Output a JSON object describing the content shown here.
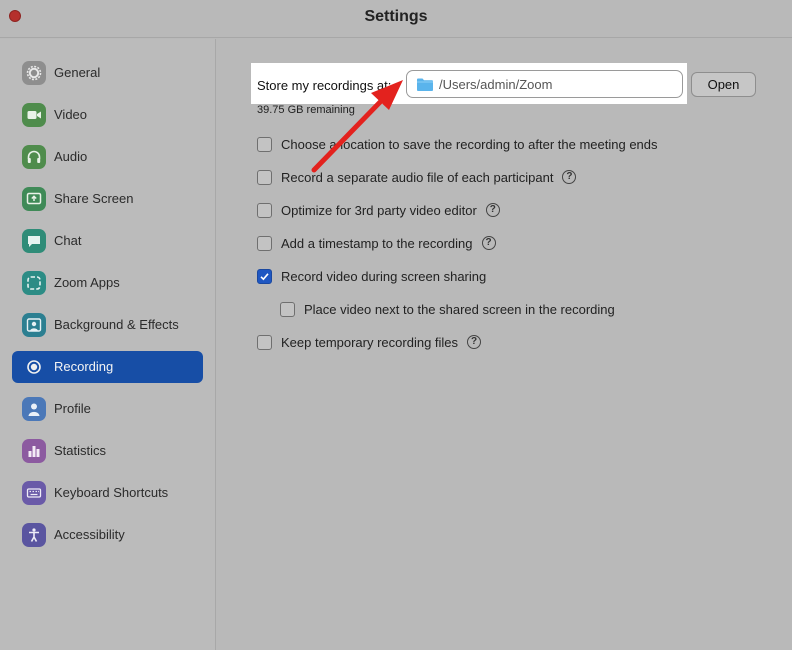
{
  "window": {
    "title": "Settings"
  },
  "sidebar": {
    "items": [
      {
        "label": "General",
        "icon": "gear-icon",
        "color": "#8e8e8e",
        "active": false
      },
      {
        "label": "Video",
        "icon": "video-camera-icon",
        "color": "#4f8c4c",
        "active": false
      },
      {
        "label": "Audio",
        "icon": "headphones-icon",
        "color": "#4f8c4c",
        "active": false
      },
      {
        "label": "Share Screen",
        "icon": "share-screen-icon",
        "color": "#3f8a57",
        "active": false
      },
      {
        "label": "Chat",
        "icon": "chat-bubble-icon",
        "color": "#2f8c78",
        "active": false
      },
      {
        "label": "Zoom Apps",
        "icon": "apps-icon",
        "color": "#2c8c85",
        "active": false
      },
      {
        "label": "Background & Effects",
        "icon": "background-person-icon",
        "color": "#2c7f91",
        "active": false
      },
      {
        "label": "Recording",
        "icon": "record-icon",
        "color": "#174ea6",
        "active": true
      },
      {
        "label": "Profile",
        "icon": "person-icon",
        "color": "#4b78b8",
        "active": false
      },
      {
        "label": "Statistics",
        "icon": "bar-chart-icon",
        "color": "#8c5aa0",
        "active": false
      },
      {
        "label": "Keyboard Shortcuts",
        "icon": "keyboard-icon",
        "color": "#6a5aa8",
        "active": false
      },
      {
        "label": "Accessibility",
        "icon": "accessibility-icon",
        "color": "#5a55a0",
        "active": false
      }
    ]
  },
  "recording": {
    "store_label": "Store my recordings at:",
    "path": "/Users/admin/Zoom",
    "open_label": "Open",
    "remaining": "39.75 GB remaining",
    "options": [
      {
        "label": "Choose a location to save the recording to after the meeting ends",
        "checked": false,
        "help": false,
        "indent": false
      },
      {
        "label": "Record a separate audio file of each participant",
        "checked": false,
        "help": true,
        "indent": false
      },
      {
        "label": "Optimize for 3rd party video editor",
        "checked": false,
        "help": true,
        "indent": false
      },
      {
        "label": "Add a timestamp to the recording",
        "checked": false,
        "help": true,
        "indent": false
      },
      {
        "label": "Record video during screen sharing",
        "checked": true,
        "help": false,
        "indent": false
      },
      {
        "label": "Place video next to the shared screen in the recording",
        "checked": false,
        "help": false,
        "indent": true
      },
      {
        "label": "Keep temporary recording files",
        "checked": false,
        "help": true,
        "indent": false
      }
    ]
  },
  "colors": {
    "accent": "#174ea6",
    "annotation_arrow": "#e3221e",
    "background": "#b9b9b9"
  }
}
